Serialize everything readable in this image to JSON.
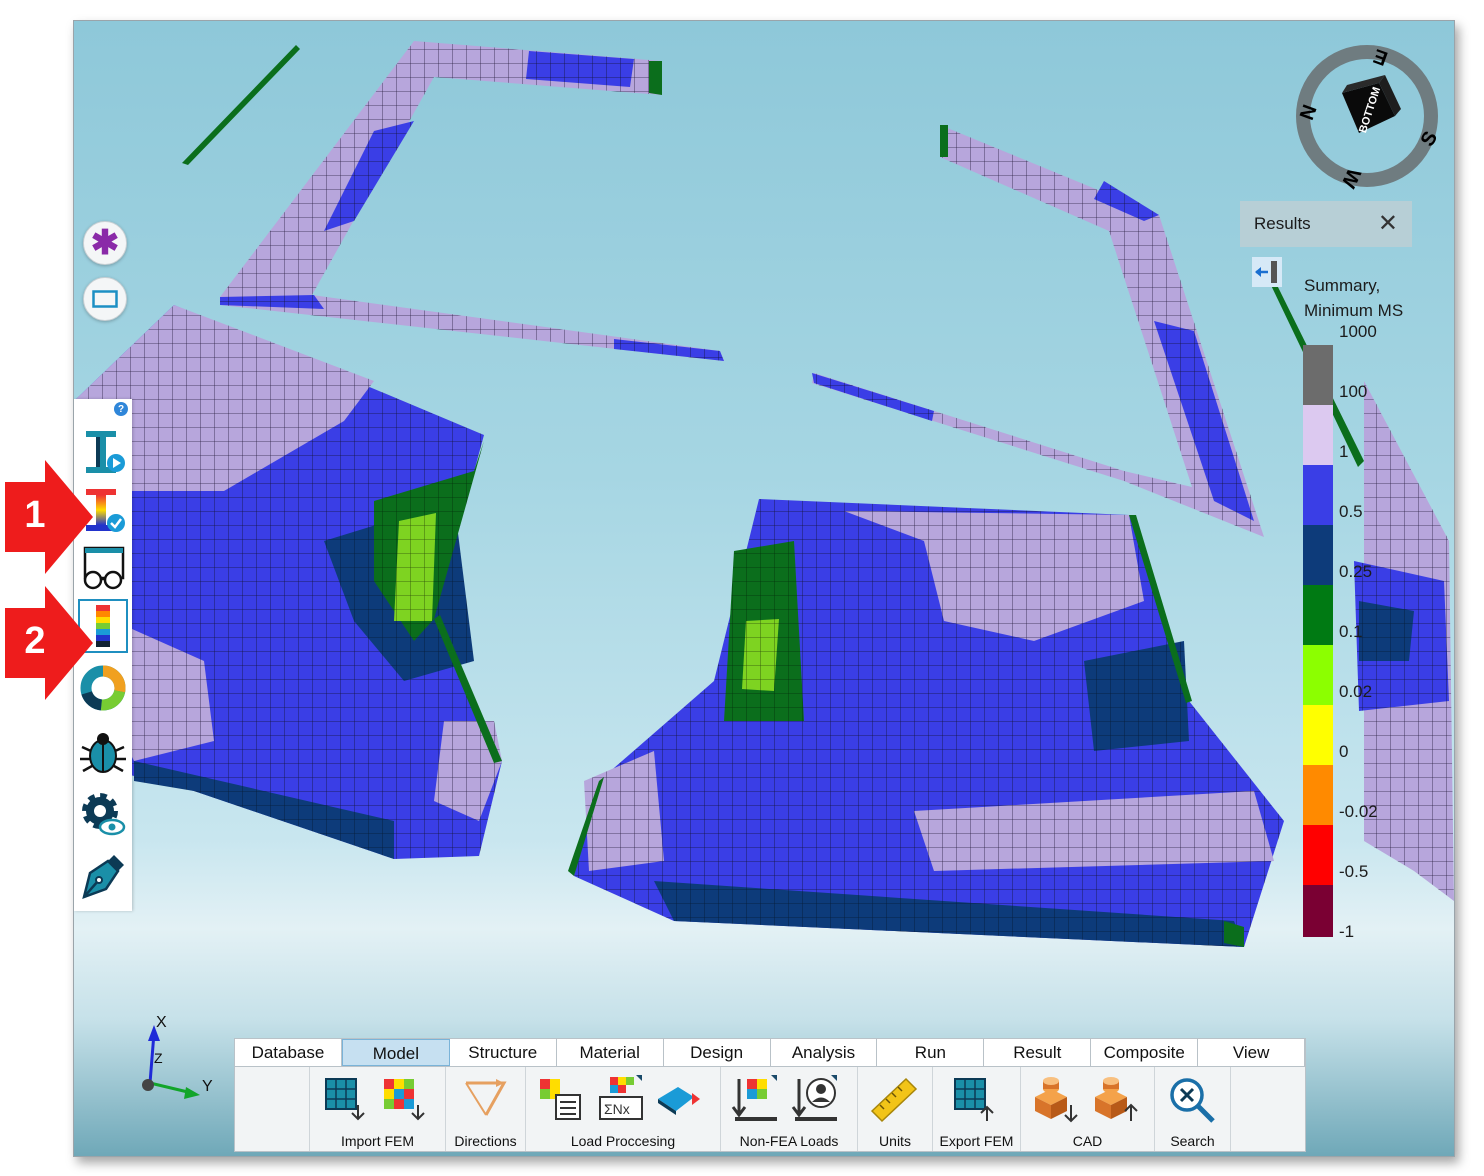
{
  "viewport": {
    "cube_face": "BOTTOM",
    "compass": [
      "E",
      "N",
      "W",
      "S"
    ]
  },
  "left_buttons": [
    {
      "name": "asterisk-icon",
      "color": "#8a2aa8"
    },
    {
      "name": "rectangle-select-icon",
      "color": "#1c8fc4"
    }
  ],
  "toolbar": {
    "help": "?",
    "items": [
      {
        "name": "beam-play-icon",
        "active": false
      },
      {
        "name": "beam-check-icon",
        "active": false
      },
      {
        "name": "glasses-view-icon",
        "active": false
      },
      {
        "name": "color-legend-icon",
        "active": true
      },
      {
        "name": "donut-chart-icon",
        "active": false
      },
      {
        "name": "bug-icon",
        "active": false
      },
      {
        "name": "gear-eye-icon",
        "active": false
      },
      {
        "name": "pen-nib-icon",
        "active": false
      }
    ]
  },
  "callouts": [
    "1",
    "2"
  ],
  "results_panel": {
    "title": "Results",
    "close": "✕",
    "legend_title": "Summary,\nMinimum MS",
    "legend": [
      {
        "label": "1000",
        "color": "#6c6c6c"
      },
      {
        "label": "100",
        "color": "#dcc9f0"
      },
      {
        "label": "1",
        "color": "#3a3ee6"
      },
      {
        "label": "0.5",
        "color": "#0d3b7a"
      },
      {
        "label": "0.25",
        "color": "#007a13"
      },
      {
        "label": "0.1",
        "color": "#8cff00"
      },
      {
        "label": "0.02",
        "color": "#ffff00"
      },
      {
        "label": "0",
        "color": "#ff8a00"
      },
      {
        "label": "-0.02",
        "color": "#ff0000"
      },
      {
        "label": "-0.5",
        "color": "#7a0033"
      },
      {
        "label": "-1",
        "color": ""
      }
    ]
  },
  "axis": {
    "x": "X",
    "y": "Y",
    "z": "Z"
  },
  "ribbon": {
    "tabs": [
      "Database",
      "Model",
      "Structure",
      "Material",
      "Design",
      "Analysis",
      "Run",
      "Result",
      "Composite",
      "View"
    ],
    "selected_tab": "Model",
    "groups": [
      {
        "label": "Import FEM"
      },
      {
        "label": "Directions"
      },
      {
        "label": "Load Proccesing"
      },
      {
        "label": "Non-FEA Loads"
      },
      {
        "label": "Units"
      },
      {
        "label": "Export FEM"
      },
      {
        "label": "CAD"
      },
      {
        "label": "Search"
      }
    ]
  },
  "colors": {
    "accent": "#1f8fc0",
    "callout": "#ee1c1c",
    "mesh_blue": "#3a3ee6",
    "mesh_lavender": "#b7a6dc",
    "mesh_dark": "#0d3b7a",
    "mesh_green": "#007a13",
    "mesh_lime": "#7ed321"
  }
}
